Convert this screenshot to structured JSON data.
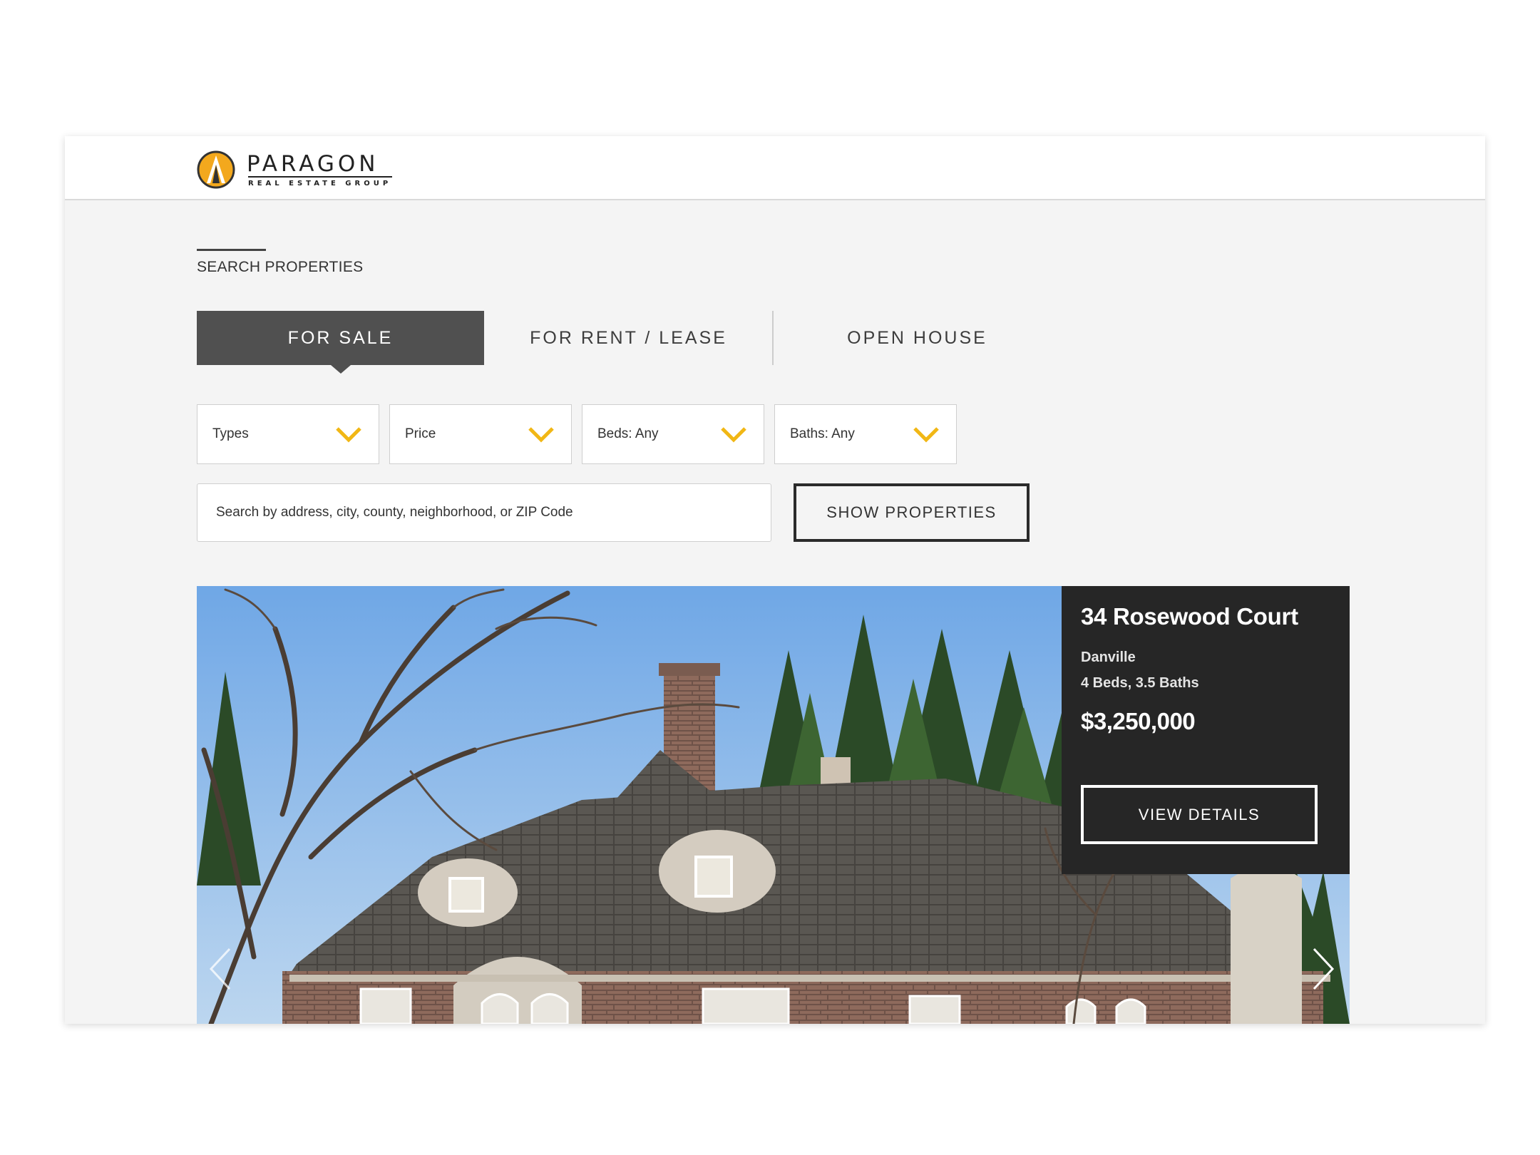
{
  "brand": {
    "name": "PARAGON",
    "tagline": "REAL ESTATE GROUP",
    "accent_color": "#f3a81d"
  },
  "search": {
    "section_title": "SEARCH PROPERTIES",
    "tabs": [
      {
        "label": "FOR SALE",
        "active": true
      },
      {
        "label": "FOR RENT / LEASE",
        "active": false
      },
      {
        "label": "OPEN HOUSE",
        "active": false
      }
    ],
    "filters": [
      {
        "label": "Types"
      },
      {
        "label": "Price"
      },
      {
        "label": "Beds: Any"
      },
      {
        "label": "Baths: Any"
      }
    ],
    "input_placeholder": "Search by address, city, county, neighborhood, or ZIP Code",
    "submit_label": "SHOW PROPERTIES",
    "chevron_color": "#f1b715"
  },
  "featured": {
    "address": "34 Rosewood Court",
    "city": "Danville",
    "beds_baths": "4 Beds, 3.5 Baths",
    "price": "$3,250,000",
    "cta_label": "VIEW DETAILS",
    "icons": {
      "prev": "chevron-left-icon",
      "next": "chevron-right-icon"
    }
  }
}
